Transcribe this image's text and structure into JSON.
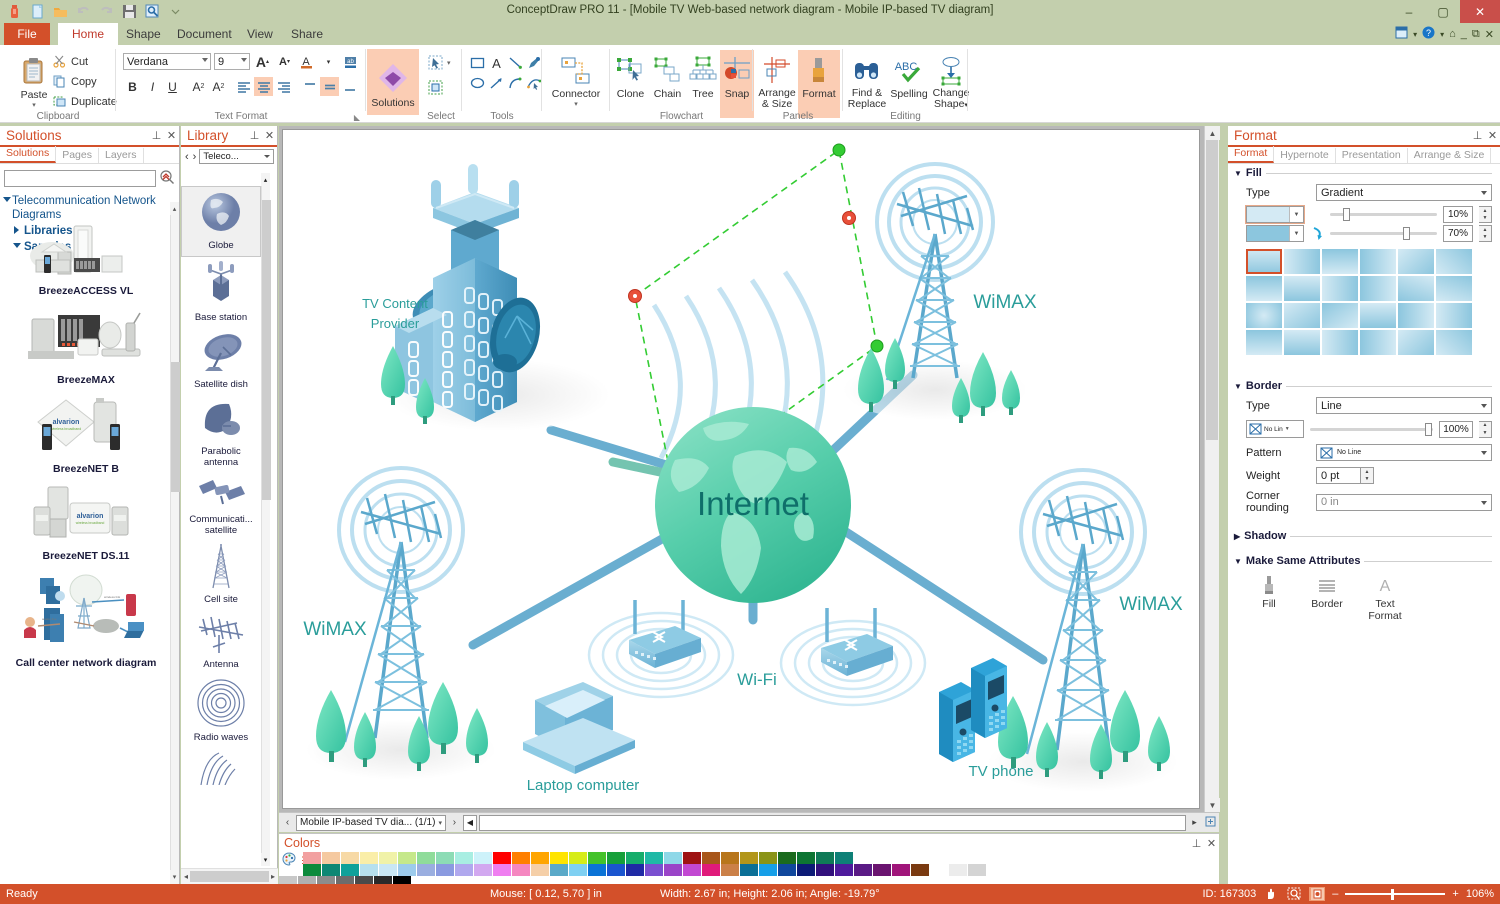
{
  "window": {
    "title": "ConceptDraw PRO 11 - [Mobile TV Web-based network diagram - Mobile IP-based TV diagram]",
    "minimize": "–",
    "maximize": "▢",
    "close": "✕"
  },
  "quick_access": [
    {
      "name": "app-logo-icon",
      "glyph": "▮"
    },
    {
      "name": "new-document-icon",
      "glyph": "▤"
    },
    {
      "name": "open-folder-icon",
      "glyph": "▰"
    },
    {
      "name": "undo-icon",
      "glyph": "↶"
    },
    {
      "name": "redo-icon",
      "glyph": "↷"
    },
    {
      "name": "save-icon",
      "glyph": "▣"
    },
    {
      "name": "preview-search-icon",
      "glyph": "▣"
    },
    {
      "name": "customize-qat-icon",
      "glyph": "▾"
    }
  ],
  "ribbon_tabs": [
    {
      "label": "File",
      "id": "file"
    },
    {
      "label": "Home",
      "id": "home",
      "active": true
    },
    {
      "label": "Shape",
      "id": "shape"
    },
    {
      "label": "Document",
      "id": "document"
    },
    {
      "label": "View",
      "id": "view"
    },
    {
      "label": "Share",
      "id": "share"
    }
  ],
  "ribbon_right_icons": [
    {
      "name": "ribbon-display-options-icon",
      "glyph": "▦"
    },
    {
      "name": "help-icon",
      "glyph": "?"
    },
    {
      "name": "restore-ribbon-icon",
      "glyph": "⌂"
    },
    {
      "name": "minimize-window-icon",
      "glyph": "_"
    },
    {
      "name": "restore-window-icon",
      "glyph": "⧉"
    },
    {
      "name": "close-window-icon",
      "glyph": "✕"
    }
  ],
  "ribbon": {
    "clipboard": {
      "group_label": "Clipboard",
      "paste": "Paste",
      "items": [
        {
          "label": "Cut",
          "icon": "scissors-icon"
        },
        {
          "label": "Copy",
          "icon": "copy-icon"
        },
        {
          "label": "Duplicate",
          "icon": "duplicate-icon"
        }
      ]
    },
    "text_format": {
      "group_label": "Text Format",
      "font_family": "Verdana",
      "font_size": "9",
      "buttons": [
        {
          "label": "A",
          "name": "grow-font-button"
        },
        {
          "label": "A",
          "name": "shrink-font-button"
        },
        {
          "label": "A",
          "name": "font-color-button"
        },
        {
          "label": "ab",
          "name": "text-highlight-button"
        },
        {
          "label": "B",
          "name": "bold-button"
        },
        {
          "label": "I",
          "name": "italic-button"
        },
        {
          "label": "U",
          "name": "underline-button"
        },
        {
          "label": "A²",
          "name": "superscript-button"
        },
        {
          "label": "A₂",
          "name": "subscript-button"
        },
        {
          "label": "≡",
          "name": "align-left-button"
        },
        {
          "label": "≡",
          "name": "align-center-button"
        },
        {
          "label": "≡",
          "name": "align-right-button"
        },
        {
          "label": "⎺",
          "name": "align-top-button"
        },
        {
          "label": "=",
          "name": "align-middle-button"
        },
        {
          "label": "⎯",
          "name": "align-bottom-button"
        },
        {
          "label": "◈",
          "name": "text-rotate-button"
        }
      ]
    },
    "solutions": {
      "label": "Solutions",
      "name": "solutions-button"
    },
    "select": {
      "group_label": "Select",
      "items": [
        {
          "name": "select-pointer-button",
          "glyph": "⬚"
        },
        {
          "name": "select-area-button",
          "glyph": "▣"
        }
      ]
    },
    "tools": {
      "group_label": "Tools",
      "items": [
        {
          "name": "rectangle-tool",
          "glyph": "▭"
        },
        {
          "name": "text-tool",
          "glyph": "A"
        },
        {
          "name": "line-tool",
          "glyph": "╲"
        },
        {
          "name": "pen-tool",
          "glyph": "✒"
        },
        {
          "name": "ellipse-tool",
          "glyph": "○"
        },
        {
          "name": "arrow-tool",
          "glyph": "↗"
        },
        {
          "name": "arc-tool",
          "glyph": "⌒"
        },
        {
          "name": "bezier-tool",
          "glyph": "✦"
        }
      ]
    },
    "flowchart": {
      "group_label": "Flowchart",
      "connector": "Connector",
      "items": [
        {
          "label": "Clone",
          "name": "clone-button"
        },
        {
          "label": "Chain",
          "name": "chain-button"
        },
        {
          "label": "Tree",
          "name": "tree-button"
        },
        {
          "label": "Snap",
          "name": "snap-button",
          "selected": true
        }
      ]
    },
    "panels": {
      "group_label": "Panels",
      "items": [
        {
          "label": "Arrange\n& Size",
          "line1": "Arrange",
          "line2": "& Size",
          "name": "arrange-size-button"
        },
        {
          "label": "Format",
          "line1": "Format",
          "line2": "",
          "name": "format-panel-button",
          "selected": true
        }
      ]
    },
    "editing": {
      "group_label": "Editing",
      "items": [
        {
          "line1": "Find &",
          "line2": "Replace",
          "name": "find-replace-button"
        },
        {
          "line1": "Spelling",
          "line2": "",
          "name": "spelling-button"
        },
        {
          "line1": "Change",
          "line2": "Shape",
          "name": "change-shape-button"
        }
      ]
    }
  },
  "solutions_panel": {
    "title": "Solutions",
    "pin": "⊥",
    "close": "✕",
    "tabs": [
      {
        "label": "Solutions",
        "active": true
      },
      {
        "label": "Pages",
        "active": false
      },
      {
        "label": "Layers",
        "active": false
      }
    ],
    "search_value": "",
    "search_placeholder": "",
    "search_icon": "search-solutions-icon",
    "tree": [
      {
        "label": "Telecommunication Network Diagrams",
        "expanded": true,
        "level": 0
      },
      {
        "label": "Libraries",
        "expanded": false,
        "level": 1
      },
      {
        "label": "Samples",
        "expanded": true,
        "level": 1
      }
    ],
    "samples": [
      {
        "caption": "BreezeACCESS VL"
      },
      {
        "caption": "BreezeMAX"
      },
      {
        "caption": "BreezeNET B"
      },
      {
        "caption": "BreezeNET DS.11"
      },
      {
        "caption": "Call center network diagram"
      }
    ]
  },
  "library_panel": {
    "title": "Library",
    "pin": "⊥",
    "close": "✕",
    "prev": "‹",
    "next": "›",
    "selector_value": "Teleco...",
    "items": [
      {
        "caption": "Globe",
        "selected": true,
        "icon": "globe-shape-icon"
      },
      {
        "caption": "Base station",
        "selected": false,
        "icon": "base-station-shape-icon"
      },
      {
        "caption": "Satellite dish",
        "selected": false,
        "icon": "satellite-dish-shape-icon"
      },
      {
        "caption": "Parabolic antenna",
        "selected": false,
        "icon": "parabolic-antenna-shape-icon"
      },
      {
        "caption": "Communicati... satellite",
        "selected": false,
        "icon": "communication-satellite-shape-icon"
      },
      {
        "caption": "Cell site",
        "selected": false,
        "icon": "cell-site-shape-icon"
      },
      {
        "caption": "Antenna",
        "selected": false,
        "icon": "antenna-shape-icon"
      },
      {
        "caption": "Radio waves",
        "selected": false,
        "icon": "radio-waves-shape-icon"
      }
    ]
  },
  "canvas": {
    "labels": {
      "tv_content_provider_line1": "TV Content",
      "tv_content_provider_line2": "Provider",
      "internet": "Internet",
      "wimax_top_right": "WiMAX",
      "wimax_bottom_left": "WiMAX",
      "wimax_bottom_right": "WiMAX",
      "wifi": "Wi-Fi",
      "laptop": "Laptop computer",
      "tv_phone": "TV phone"
    },
    "colors": {
      "label_teal": "#2a9d9a",
      "node_blue": "#5ba8cc",
      "link_blue": "#6aaed0",
      "globe_green": "#4cc6a8",
      "selection_green": "#33cc33",
      "handle_red": "#e8503a"
    }
  },
  "page_bar": {
    "prev": "‹",
    "next": "›",
    "tab_label": "Mobile IP-based TV dia... (1/1)",
    "tab_caret": "▾",
    "insert_page": "◀"
  },
  "colors_panel": {
    "title": "Colors",
    "pin": "⊥",
    "close": "✕",
    "palette_icon": "color-palette-icon",
    "menu_icon": "color-menu-icon",
    "row1": [
      "#f2a0a0",
      "#f5c9a0",
      "#f7d9a5",
      "#faeea8",
      "#f0f2a8",
      "#c5e88a",
      "#8fdc9a",
      "#8cdcb5",
      "#a8eee2",
      "#cdf2fa",
      "#ff0000",
      "#ff7f00",
      "#ffa500",
      "#ffe400",
      "#d6ec18",
      "#44c22a",
      "#17a03a",
      "#16ad6b",
      "#1fb9a6",
      "#8ed8e8",
      "#9e1313",
      "#a8561a",
      "#b8761c",
      "#b2961a",
      "#8a9418",
      "#1b6b1e",
      "#0d7533",
      "#0f7a57",
      "#0e8077"
    ],
    "row2": [
      "#0c8a3c",
      "#0e8774",
      "#10a19a",
      "#b6e0ee",
      "#c9e7f5",
      "#9ccbec",
      "#9aaee0",
      "#8a9ae0",
      "#b0a8ee",
      "#d2a8f0",
      "#ef7ef0",
      "#f587c0",
      "#f5cfa8",
      "#5aa9c8",
      "#7fd0f2",
      "#0b73d6",
      "#1a55cf",
      "#1f2aa5",
      "#7a4fd0",
      "#9a44c8",
      "#c248d2",
      "#e01a7a",
      "#cb8048",
      "#0b6f96",
      "#169fe8",
      "#10479c",
      "#0c1a76",
      "#32107c",
      "#4e1a9c",
      "#5a1a85",
      "#6a1470",
      "#a0157a",
      "#7a3a10",
      "#ffffff",
      "#ececec",
      "#d4d4d4"
    ],
    "grays": [
      "#c8c8c8",
      "#b0b0b0",
      "#8c8c8c",
      "#6c6c6c",
      "#4a4a4a",
      "#2a2a2a",
      "#000000"
    ]
  },
  "format_panel": {
    "title": "Format",
    "pin": "⊥",
    "close": "✕",
    "tabs": [
      {
        "label": "Format",
        "active": true
      },
      {
        "label": "Hypernote",
        "active": false
      },
      {
        "label": "Presentation",
        "active": false
      },
      {
        "label": "Arrange & Size",
        "active": false
      }
    ],
    "fill": {
      "section": "Fill",
      "type_label": "Type",
      "type_value": "Gradient",
      "color1": "#d4eaf4",
      "color2": "#8cc6de",
      "stop1_percent": "10%",
      "stop2_percent": "70%",
      "swap_icon": "swap-colors-icon",
      "gradient_presets_rows": 4,
      "gradient_presets_cols": 6,
      "selected_preset_index": 0
    },
    "border": {
      "section": "Border",
      "type_label": "Type",
      "type_value": "Line",
      "line_style_value": "No Lin",
      "opacity_value": "100%",
      "pattern_label": "Pattern",
      "pattern_value": "No Line",
      "weight_label": "Weight",
      "weight_value": "0 pt",
      "corner_label": "Corner rounding",
      "corner_value": "0 in"
    },
    "shadow": {
      "section": "Shadow",
      "expanded": false
    },
    "make_same": {
      "section": "Make Same Attributes",
      "items": [
        {
          "line1": "Fill",
          "line2": "",
          "name": "make-same-fill-button",
          "icon": "fill-brush-icon"
        },
        {
          "line1": "Border",
          "line2": "",
          "name": "make-same-border-button",
          "icon": "border-lines-icon"
        },
        {
          "line1": "Text",
          "line2": "Format",
          "name": "make-same-text-format-button",
          "icon": "text-a-icon"
        }
      ]
    }
  },
  "status_bar": {
    "ready": "Ready",
    "mouse": "Mouse: [ 0.12, 5.70 ] in",
    "dimensions": "Width: 2.67 in;  Height: 2.06 in;  Angle: -19.79°",
    "id": "ID: 167303",
    "hand_icon": "pan-hand-icon",
    "zoom_select_icon": "zoom-selection-icon",
    "fit_icon": "fit-page-icon",
    "zoom_out": "–",
    "zoom_in": "+",
    "zoom_level": "106%"
  }
}
